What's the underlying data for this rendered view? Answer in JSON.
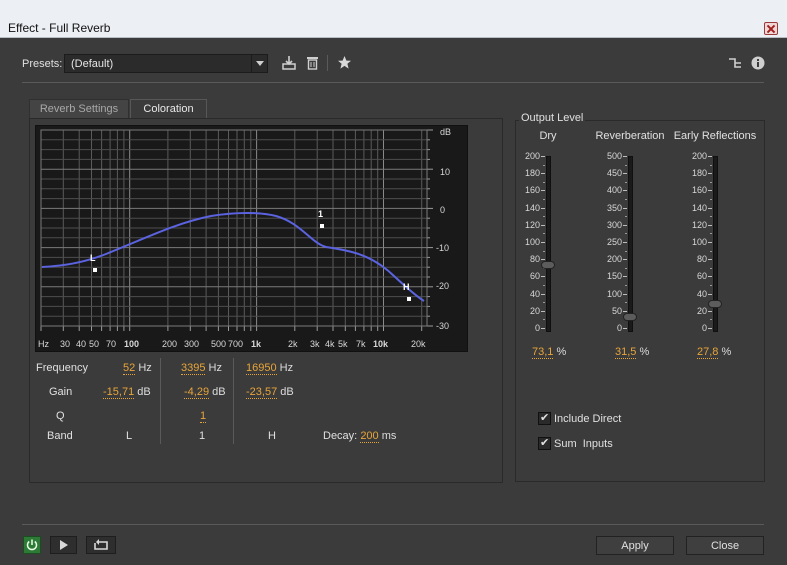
{
  "window": {
    "title": "Effect - Full Reverb"
  },
  "presets": {
    "label": "Presets:",
    "value": "(Default)"
  },
  "tabs": [
    {
      "label": "Reverb Settings",
      "active": false
    },
    {
      "label": "Coloration",
      "active": true
    }
  ],
  "graph": {
    "y_unit": "dB",
    "y_ticks": [
      "10",
      "0",
      "-10",
      "-20",
      "-30"
    ],
    "x_ticks": [
      "Hz",
      "30",
      "40",
      "50",
      "70",
      "100",
      "200",
      "300",
      "500",
      "700",
      "1k",
      "2k",
      "3k",
      "4k",
      "5k",
      "7k",
      "10k",
      "20k"
    ],
    "nodes": [
      {
        "label": "L"
      },
      {
        "label": "1"
      },
      {
        "label": "H"
      }
    ],
    "curve_color": "#5b63e0"
  },
  "eq": {
    "labels": {
      "frequency": "Frequency",
      "gain": "Gain",
      "q": "Q",
      "band": "Band"
    },
    "bands": [
      {
        "frequency": "52",
        "freq_unit": "Hz",
        "gain": "-15,71",
        "gain_unit": "dB",
        "q": "",
        "band": "L"
      },
      {
        "frequency": "3395",
        "freq_unit": "Hz",
        "gain": "-4,29",
        "gain_unit": "dB",
        "q": "1",
        "band": "1"
      },
      {
        "frequency": "16950",
        "freq_unit": "Hz",
        "gain": "-23,57",
        "gain_unit": "dB",
        "q": "",
        "band": "H"
      }
    ],
    "decay": {
      "label": "Decay:",
      "value": "200",
      "unit": "ms"
    }
  },
  "output_level": {
    "title": "Output Level",
    "columns": [
      {
        "label": "Dry",
        "scale": [
          "200",
          "180",
          "160",
          "140",
          "120",
          "100",
          "80",
          "60",
          "40",
          "20",
          "0"
        ],
        "max": 200,
        "value_pct": "73,1",
        "unit": "%"
      },
      {
        "label": "Reverberation",
        "scale": [
          "500",
          "450",
          "400",
          "350",
          "300",
          "250",
          "200",
          "150",
          "100",
          "50",
          "0"
        ],
        "max": 500,
        "value_pct": "31,5",
        "unit": "%"
      },
      {
        "label": "Early Reflections",
        "scale": [
          "200",
          "180",
          "160",
          "140",
          "120",
          "100",
          "80",
          "60",
          "40",
          "20",
          "0"
        ],
        "max": 200,
        "value_pct": "27,8",
        "unit": "%"
      }
    ],
    "include_direct": {
      "label": "Include Direct",
      "checked": true
    },
    "sum_inputs": {
      "label": "Sum  Inputs",
      "checked": true
    }
  },
  "footer": {
    "apply_label": "Apply",
    "close_label": "Close"
  },
  "colors": {
    "accent": "#e8a53a",
    "power": "#3aa54a",
    "background": "#3b3b3b"
  }
}
